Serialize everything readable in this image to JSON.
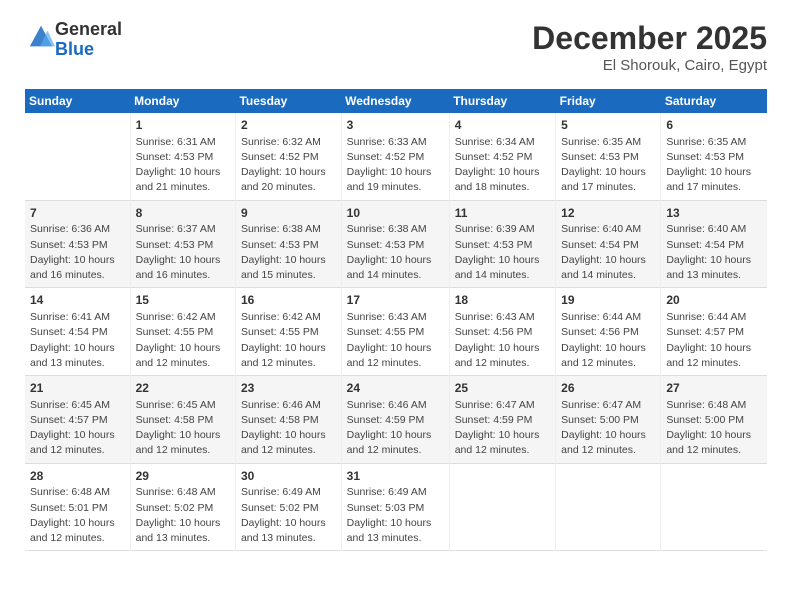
{
  "logo": {
    "general": "General",
    "blue": "Blue"
  },
  "title": "December 2025",
  "location": "El Shorouk, Cairo, Egypt",
  "days_header": [
    "Sunday",
    "Monday",
    "Tuesday",
    "Wednesday",
    "Thursday",
    "Friday",
    "Saturday"
  ],
  "weeks": [
    [
      {
        "num": "",
        "sunrise": "",
        "sunset": "",
        "daylight": ""
      },
      {
        "num": "1",
        "sunrise": "Sunrise: 6:31 AM",
        "sunset": "Sunset: 4:53 PM",
        "daylight": "Daylight: 10 hours and 21 minutes."
      },
      {
        "num": "2",
        "sunrise": "Sunrise: 6:32 AM",
        "sunset": "Sunset: 4:52 PM",
        "daylight": "Daylight: 10 hours and 20 minutes."
      },
      {
        "num": "3",
        "sunrise": "Sunrise: 6:33 AM",
        "sunset": "Sunset: 4:52 PM",
        "daylight": "Daylight: 10 hours and 19 minutes."
      },
      {
        "num": "4",
        "sunrise": "Sunrise: 6:34 AM",
        "sunset": "Sunset: 4:52 PM",
        "daylight": "Daylight: 10 hours and 18 minutes."
      },
      {
        "num": "5",
        "sunrise": "Sunrise: 6:35 AM",
        "sunset": "Sunset: 4:53 PM",
        "daylight": "Daylight: 10 hours and 17 minutes."
      },
      {
        "num": "6",
        "sunrise": "Sunrise: 6:35 AM",
        "sunset": "Sunset: 4:53 PM",
        "daylight": "Daylight: 10 hours and 17 minutes."
      }
    ],
    [
      {
        "num": "7",
        "sunrise": "Sunrise: 6:36 AM",
        "sunset": "Sunset: 4:53 PM",
        "daylight": "Daylight: 10 hours and 16 minutes."
      },
      {
        "num": "8",
        "sunrise": "Sunrise: 6:37 AM",
        "sunset": "Sunset: 4:53 PM",
        "daylight": "Daylight: 10 hours and 16 minutes."
      },
      {
        "num": "9",
        "sunrise": "Sunrise: 6:38 AM",
        "sunset": "Sunset: 4:53 PM",
        "daylight": "Daylight: 10 hours and 15 minutes."
      },
      {
        "num": "10",
        "sunrise": "Sunrise: 6:38 AM",
        "sunset": "Sunset: 4:53 PM",
        "daylight": "Daylight: 10 hours and 14 minutes."
      },
      {
        "num": "11",
        "sunrise": "Sunrise: 6:39 AM",
        "sunset": "Sunset: 4:53 PM",
        "daylight": "Daylight: 10 hours and 14 minutes."
      },
      {
        "num": "12",
        "sunrise": "Sunrise: 6:40 AM",
        "sunset": "Sunset: 4:54 PM",
        "daylight": "Daylight: 10 hours and 14 minutes."
      },
      {
        "num": "13",
        "sunrise": "Sunrise: 6:40 AM",
        "sunset": "Sunset: 4:54 PM",
        "daylight": "Daylight: 10 hours and 13 minutes."
      }
    ],
    [
      {
        "num": "14",
        "sunrise": "Sunrise: 6:41 AM",
        "sunset": "Sunset: 4:54 PM",
        "daylight": "Daylight: 10 hours and 13 minutes."
      },
      {
        "num": "15",
        "sunrise": "Sunrise: 6:42 AM",
        "sunset": "Sunset: 4:55 PM",
        "daylight": "Daylight: 10 hours and 12 minutes."
      },
      {
        "num": "16",
        "sunrise": "Sunrise: 6:42 AM",
        "sunset": "Sunset: 4:55 PM",
        "daylight": "Daylight: 10 hours and 12 minutes."
      },
      {
        "num": "17",
        "sunrise": "Sunrise: 6:43 AM",
        "sunset": "Sunset: 4:55 PM",
        "daylight": "Daylight: 10 hours and 12 minutes."
      },
      {
        "num": "18",
        "sunrise": "Sunrise: 6:43 AM",
        "sunset": "Sunset: 4:56 PM",
        "daylight": "Daylight: 10 hours and 12 minutes."
      },
      {
        "num": "19",
        "sunrise": "Sunrise: 6:44 AM",
        "sunset": "Sunset: 4:56 PM",
        "daylight": "Daylight: 10 hours and 12 minutes."
      },
      {
        "num": "20",
        "sunrise": "Sunrise: 6:44 AM",
        "sunset": "Sunset: 4:57 PM",
        "daylight": "Daylight: 10 hours and 12 minutes."
      }
    ],
    [
      {
        "num": "21",
        "sunrise": "Sunrise: 6:45 AM",
        "sunset": "Sunset: 4:57 PM",
        "daylight": "Daylight: 10 hours and 12 minutes."
      },
      {
        "num": "22",
        "sunrise": "Sunrise: 6:45 AM",
        "sunset": "Sunset: 4:58 PM",
        "daylight": "Daylight: 10 hours and 12 minutes."
      },
      {
        "num": "23",
        "sunrise": "Sunrise: 6:46 AM",
        "sunset": "Sunset: 4:58 PM",
        "daylight": "Daylight: 10 hours and 12 minutes."
      },
      {
        "num": "24",
        "sunrise": "Sunrise: 6:46 AM",
        "sunset": "Sunset: 4:59 PM",
        "daylight": "Daylight: 10 hours and 12 minutes."
      },
      {
        "num": "25",
        "sunrise": "Sunrise: 6:47 AM",
        "sunset": "Sunset: 4:59 PM",
        "daylight": "Daylight: 10 hours and 12 minutes."
      },
      {
        "num": "26",
        "sunrise": "Sunrise: 6:47 AM",
        "sunset": "Sunset: 5:00 PM",
        "daylight": "Daylight: 10 hours and 12 minutes."
      },
      {
        "num": "27",
        "sunrise": "Sunrise: 6:48 AM",
        "sunset": "Sunset: 5:00 PM",
        "daylight": "Daylight: 10 hours and 12 minutes."
      }
    ],
    [
      {
        "num": "28",
        "sunrise": "Sunrise: 6:48 AM",
        "sunset": "Sunset: 5:01 PM",
        "daylight": "Daylight: 10 hours and 12 minutes."
      },
      {
        "num": "29",
        "sunrise": "Sunrise: 6:48 AM",
        "sunset": "Sunset: 5:02 PM",
        "daylight": "Daylight: 10 hours and 13 minutes."
      },
      {
        "num": "30",
        "sunrise": "Sunrise: 6:49 AM",
        "sunset": "Sunset: 5:02 PM",
        "daylight": "Daylight: 10 hours and 13 minutes."
      },
      {
        "num": "31",
        "sunrise": "Sunrise: 6:49 AM",
        "sunset": "Sunset: 5:03 PM",
        "daylight": "Daylight: 10 hours and 13 minutes."
      },
      {
        "num": "",
        "sunrise": "",
        "sunset": "",
        "daylight": ""
      },
      {
        "num": "",
        "sunrise": "",
        "sunset": "",
        "daylight": ""
      },
      {
        "num": "",
        "sunrise": "",
        "sunset": "",
        "daylight": ""
      }
    ]
  ]
}
